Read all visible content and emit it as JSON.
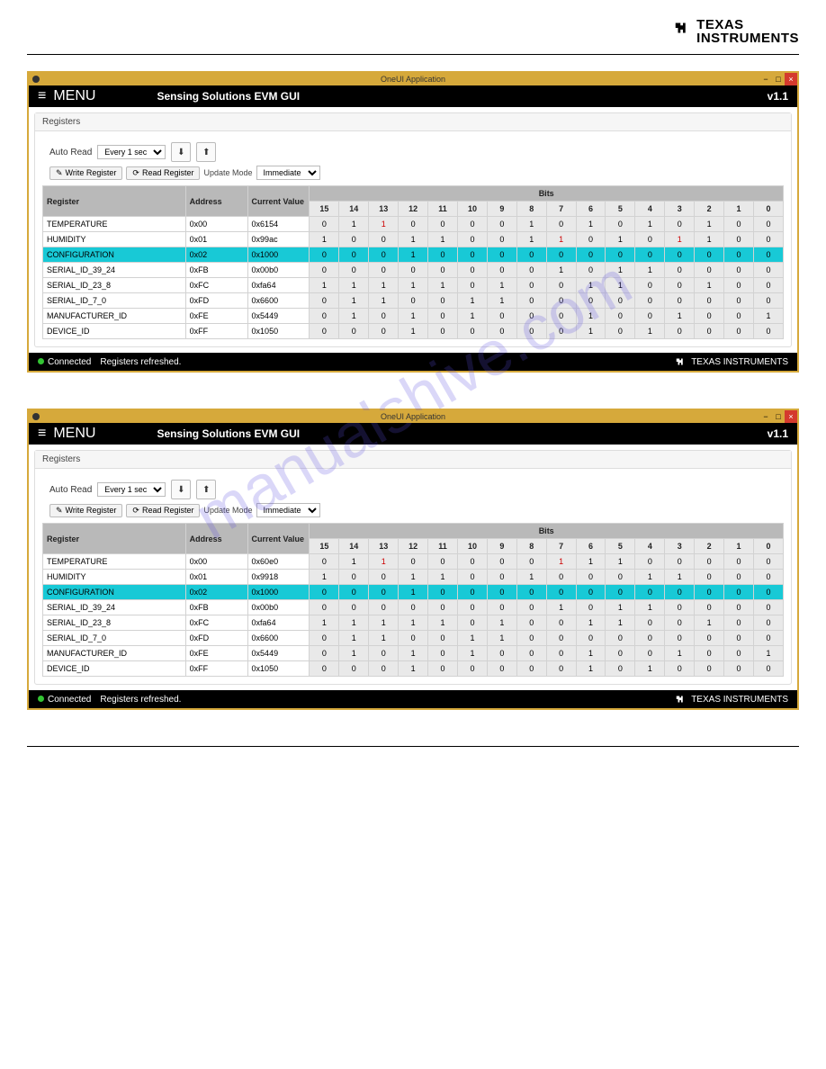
{
  "header_logo": {
    "l1": "TEXAS",
    "l2": "INSTRUMENTS"
  },
  "watermark": "manualshive.com",
  "app": {
    "titlebar": "OneUI Application",
    "menu_icon": "≡",
    "menu_label": "MENU",
    "gui_title": "Sensing Solutions EVM GUI",
    "version": "v1.1",
    "panel_title": "Registers",
    "auto_read_label": "Auto Read",
    "auto_read_value": "Every 1 sec",
    "dl_icon": "⬇",
    "ul_icon": "⬆",
    "write_btn": "Write Register",
    "read_btn": "Read Register",
    "update_mode_label": "Update Mode",
    "update_mode_value": "Immediate",
    "cols": {
      "reg": "Register",
      "addr": "Address",
      "val": "Current Value",
      "bits": "Bits"
    },
    "bit_headers": [
      "15",
      "14",
      "13",
      "12",
      "11",
      "10",
      "9",
      "8",
      "7",
      "6",
      "5",
      "4",
      "3",
      "2",
      "1",
      "0"
    ],
    "status_connected": "Connected",
    "status_msg": "Registers refreshed.",
    "footer_brand": "TEXAS INSTRUMENTS"
  },
  "table1": [
    {
      "reg": "TEMPERATURE",
      "addr": "0x00",
      "val": "0x6154",
      "bits": [
        "0",
        "1",
        "1",
        "0",
        "0",
        "0",
        "0",
        "1",
        "0",
        "1",
        "0",
        "1",
        "0",
        "1",
        "0",
        "0"
      ],
      "red": [
        2
      ]
    },
    {
      "reg": "HUMIDITY",
      "addr": "0x01",
      "val": "0x99ac",
      "bits": [
        "1",
        "0",
        "0",
        "1",
        "1",
        "0",
        "0",
        "1",
        "1",
        "0",
        "1",
        "0",
        "1",
        "1",
        "0",
        "0"
      ],
      "red": [
        8,
        12
      ]
    },
    {
      "reg": "CONFIGURATION",
      "addr": "0x02",
      "val": "0x1000",
      "bits": [
        "0",
        "0",
        "0",
        "1",
        "0",
        "0",
        "0",
        "0",
        "0",
        "0",
        "0",
        "0",
        "0",
        "0",
        "0",
        "0"
      ],
      "hl": true
    },
    {
      "reg": "SERIAL_ID_39_24",
      "addr": "0xFB",
      "val": "0x00b0",
      "bits": [
        "0",
        "0",
        "0",
        "0",
        "0",
        "0",
        "0",
        "0",
        "1",
        "0",
        "1",
        "1",
        "0",
        "0",
        "0",
        "0"
      ]
    },
    {
      "reg": "SERIAL_ID_23_8",
      "addr": "0xFC",
      "val": "0xfa64",
      "bits": [
        "1",
        "1",
        "1",
        "1",
        "1",
        "0",
        "1",
        "0",
        "0",
        "1",
        "1",
        "0",
        "0",
        "1",
        "0",
        "0"
      ]
    },
    {
      "reg": "SERIAL_ID_7_0",
      "addr": "0xFD",
      "val": "0x6600",
      "bits": [
        "0",
        "1",
        "1",
        "0",
        "0",
        "1",
        "1",
        "0",
        "0",
        "0",
        "0",
        "0",
        "0",
        "0",
        "0",
        "0"
      ]
    },
    {
      "reg": "MANUFACTURER_ID",
      "addr": "0xFE",
      "val": "0x5449",
      "bits": [
        "0",
        "1",
        "0",
        "1",
        "0",
        "1",
        "0",
        "0",
        "0",
        "1",
        "0",
        "0",
        "1",
        "0",
        "0",
        "1"
      ]
    },
    {
      "reg": "DEVICE_ID",
      "addr": "0xFF",
      "val": "0x1050",
      "bits": [
        "0",
        "0",
        "0",
        "1",
        "0",
        "0",
        "0",
        "0",
        "0",
        "1",
        "0",
        "1",
        "0",
        "0",
        "0",
        "0"
      ]
    }
  ],
  "table2": [
    {
      "reg": "TEMPERATURE",
      "addr": "0x00",
      "val": "0x60e0",
      "bits": [
        "0",
        "1",
        "1",
        "0",
        "0",
        "0",
        "0",
        "0",
        "1",
        "1",
        "1",
        "0",
        "0",
        "0",
        "0",
        "0"
      ],
      "red": [
        2,
        8
      ]
    },
    {
      "reg": "HUMIDITY",
      "addr": "0x01",
      "val": "0x9918",
      "bits": [
        "1",
        "0",
        "0",
        "1",
        "1",
        "0",
        "0",
        "1",
        "0",
        "0",
        "0",
        "1",
        "1",
        "0",
        "0",
        "0"
      ]
    },
    {
      "reg": "CONFIGURATION",
      "addr": "0x02",
      "val": "0x1000",
      "bits": [
        "0",
        "0",
        "0",
        "1",
        "0",
        "0",
        "0",
        "0",
        "0",
        "0",
        "0",
        "0",
        "0",
        "0",
        "0",
        "0"
      ],
      "hl": true
    },
    {
      "reg": "SERIAL_ID_39_24",
      "addr": "0xFB",
      "val": "0x00b0",
      "bits": [
        "0",
        "0",
        "0",
        "0",
        "0",
        "0",
        "0",
        "0",
        "1",
        "0",
        "1",
        "1",
        "0",
        "0",
        "0",
        "0"
      ]
    },
    {
      "reg": "SERIAL_ID_23_8",
      "addr": "0xFC",
      "val": "0xfa64",
      "bits": [
        "1",
        "1",
        "1",
        "1",
        "1",
        "0",
        "1",
        "0",
        "0",
        "1",
        "1",
        "0",
        "0",
        "1",
        "0",
        "0"
      ]
    },
    {
      "reg": "SERIAL_ID_7_0",
      "addr": "0xFD",
      "val": "0x6600",
      "bits": [
        "0",
        "1",
        "1",
        "0",
        "0",
        "1",
        "1",
        "0",
        "0",
        "0",
        "0",
        "0",
        "0",
        "0",
        "0",
        "0"
      ]
    },
    {
      "reg": "MANUFACTURER_ID",
      "addr": "0xFE",
      "val": "0x5449",
      "bits": [
        "0",
        "1",
        "0",
        "1",
        "0",
        "1",
        "0",
        "0",
        "0",
        "1",
        "0",
        "0",
        "1",
        "0",
        "0",
        "1"
      ]
    },
    {
      "reg": "DEVICE_ID",
      "addr": "0xFF",
      "val": "0x1050",
      "bits": [
        "0",
        "0",
        "0",
        "1",
        "0",
        "0",
        "0",
        "0",
        "0",
        "1",
        "0",
        "1",
        "0",
        "0",
        "0",
        "0"
      ]
    }
  ]
}
